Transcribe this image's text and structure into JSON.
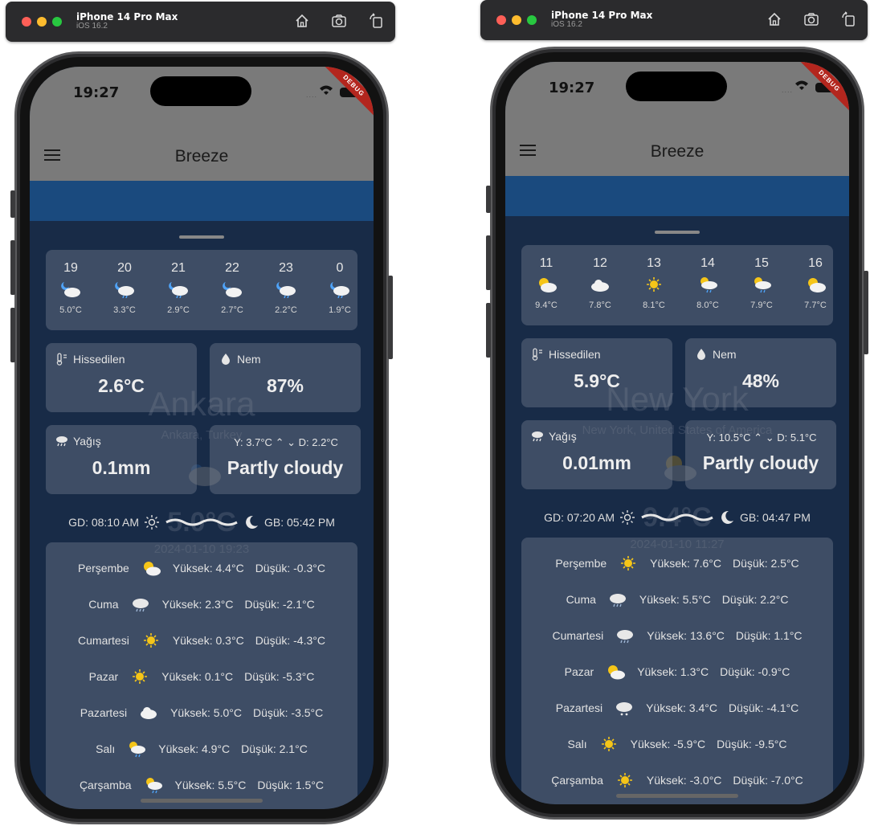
{
  "simulators": [
    {
      "device_name": "iPhone 14 Pro Max",
      "os_version": "iOS 16.2",
      "status": {
        "time": "19:27",
        "debug_label": "DEBUG",
        "signal_text": "...."
      },
      "app": {
        "title": "Breeze"
      },
      "background": {
        "city": "Ankara",
        "country": "Ankara, Turkey",
        "temp": "5.0°C",
        "datetime": "2024-01-10 19:23"
      },
      "hourly": [
        {
          "hour": "19",
          "icon": "night-cloud-icon",
          "temp": "5.0°C"
        },
        {
          "hour": "20",
          "icon": "night-rain-icon",
          "temp": "3.3°C"
        },
        {
          "hour": "21",
          "icon": "night-rain-icon",
          "temp": "2.9°C"
        },
        {
          "hour": "22",
          "icon": "night-cloud-icon",
          "temp": "2.7°C"
        },
        {
          "hour": "23",
          "icon": "night-rain-icon",
          "temp": "2.2°C"
        },
        {
          "hour": "0",
          "icon": "night-rain-icon",
          "temp": "1.9°C"
        }
      ],
      "tiles": {
        "feels_label": "Hissedilen",
        "feels_value": "2.6°C",
        "humidity_label": "Nem",
        "humidity_value": "87%",
        "precip_label": "Yağış",
        "precip_value": "0.1mm",
        "high": "Y: 3.7°C",
        "low": "D: 2.2°C",
        "condition": "Partly cloudy"
      },
      "sun": {
        "sunrise": "GD: 08:10 AM",
        "sunset": "GB: 05:42 PM"
      },
      "forecast": [
        {
          "day": "Perşembe",
          "icon": "partly-cloudy-icon",
          "high": "Yüksek: 4.4°C",
          "low": "Düşük: -0.3°C"
        },
        {
          "day": "Cuma",
          "icon": "rain-cloud-icon",
          "high": "Yüksek: 2.3°C",
          "low": "Düşük: -2.1°C"
        },
        {
          "day": "Cumartesi",
          "icon": "sun-icon",
          "high": "Yüksek: 0.3°C",
          "low": "Düşük: -4.3°C"
        },
        {
          "day": "Pazar",
          "icon": "sun-icon",
          "high": "Yüksek: 0.1°C",
          "low": "Düşük: -5.3°C"
        },
        {
          "day": "Pazartesi",
          "icon": "cloud-icon",
          "high": "Yüksek: 5.0°C",
          "low": "Düşük: -3.5°C"
        },
        {
          "day": "Salı",
          "icon": "sun-rain-icon",
          "high": "Yüksek: 4.9°C",
          "low": "Düşük: 2.1°C"
        },
        {
          "day": "Çarşamba",
          "icon": "sun-rain-icon",
          "high": "Yüksek: 5.5°C",
          "low": "Düşük: 1.5°C"
        }
      ]
    },
    {
      "device_name": "iPhone 14 Pro Max",
      "os_version": "iOS 16.2",
      "status": {
        "time": "19:27",
        "debug_label": "DEBUG",
        "signal_text": "...."
      },
      "app": {
        "title": "Breeze"
      },
      "background": {
        "city": "New York",
        "country": "New York, United States of America",
        "temp": "9.4°C",
        "datetime": "2024-01-10 11:27"
      },
      "hourly": [
        {
          "hour": "11",
          "icon": "partly-cloudy-icon",
          "temp": "9.4°C"
        },
        {
          "hour": "12",
          "icon": "cloud-icon",
          "temp": "7.8°C"
        },
        {
          "hour": "13",
          "icon": "sun-icon",
          "temp": "8.1°C"
        },
        {
          "hour": "14",
          "icon": "sun-rain-icon",
          "temp": "8.0°C"
        },
        {
          "hour": "15",
          "icon": "sun-rain-icon",
          "temp": "7.9°C"
        },
        {
          "hour": "16",
          "icon": "partly-cloudy-icon",
          "temp": "7.7°C"
        }
      ],
      "tiles": {
        "feels_label": "Hissedilen",
        "feels_value": "5.9°C",
        "humidity_label": "Nem",
        "humidity_value": "48%",
        "precip_label": "Yağış",
        "precip_value": "0.01mm",
        "high": "Y: 10.5°C",
        "low": "D: 5.1°C",
        "condition": "Partly cloudy"
      },
      "sun": {
        "sunrise": "GD: 07:20 AM",
        "sunset": "GB: 04:47 PM"
      },
      "forecast": [
        {
          "day": "Perşembe",
          "icon": "sun-icon",
          "high": "Yüksek: 7.6°C",
          "low": "Düşük: 2.5°C"
        },
        {
          "day": "Cuma",
          "icon": "rain-cloud-icon",
          "high": "Yüksek: 5.5°C",
          "low": "Düşük: 2.2°C"
        },
        {
          "day": "Cumartesi",
          "icon": "rain-cloud-icon",
          "high": "Yüksek: 13.6°C",
          "low": "Düşük: 1.1°C"
        },
        {
          "day": "Pazar",
          "icon": "partly-cloudy-icon",
          "high": "Yüksek: 1.3°C",
          "low": "Düşük: -0.9°C"
        },
        {
          "day": "Pazartesi",
          "icon": "snow-cloud-icon",
          "high": "Yüksek: 3.4°C",
          "low": "Düşük: -4.1°C"
        },
        {
          "day": "Salı",
          "icon": "sun-icon",
          "high": "Yüksek: -5.9°C",
          "low": "Düşük: -9.5°C"
        },
        {
          "day": "Çarşamba",
          "icon": "sun-icon",
          "high": "Yüksek: -3.0°C",
          "low": "Düşük: -7.0°C"
        }
      ]
    }
  ]
}
